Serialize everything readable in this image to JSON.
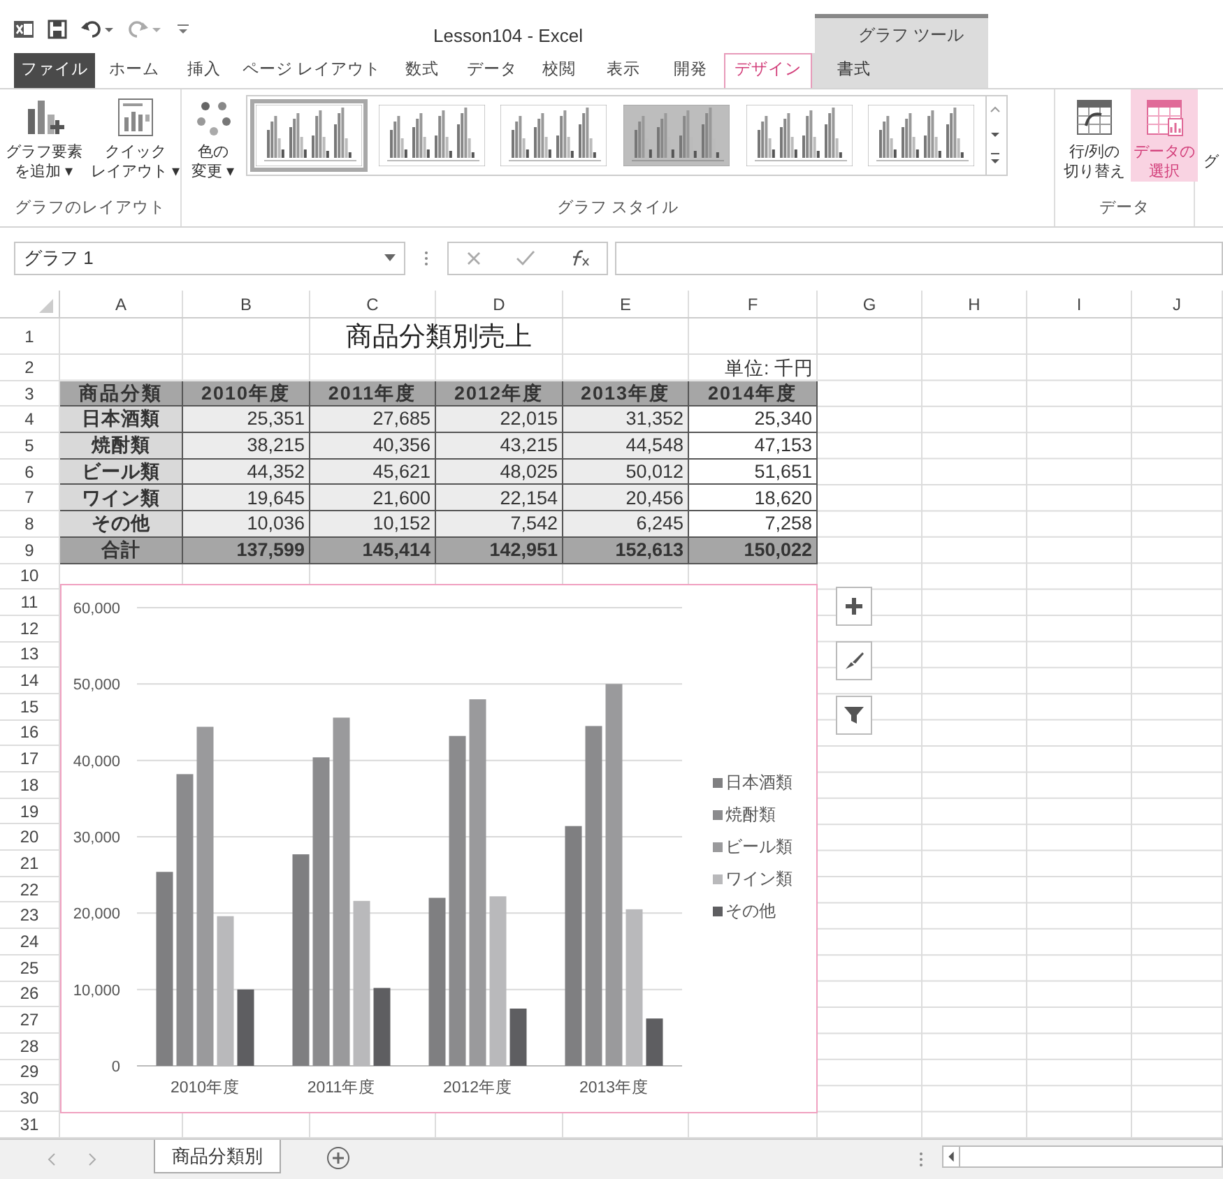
{
  "title_bar": {
    "title": "Lesson104 - Excel",
    "context_group": "グラフ ツール"
  },
  "ribbon_tabs": [
    {
      "label": "ファイル",
      "kind": "file",
      "selected": false
    },
    {
      "label": "ホーム",
      "kind": "normal",
      "selected": false
    },
    {
      "label": "挿入",
      "kind": "normal",
      "selected": false
    },
    {
      "label": "ページ レイアウト",
      "kind": "normal",
      "selected": false
    },
    {
      "label": "数式",
      "kind": "normal",
      "selected": false
    },
    {
      "label": "データ",
      "kind": "normal",
      "selected": false
    },
    {
      "label": "校閲",
      "kind": "normal",
      "selected": false
    },
    {
      "label": "表示",
      "kind": "normal",
      "selected": false
    },
    {
      "label": "開発",
      "kind": "normal",
      "selected": false
    },
    {
      "label": "デザイン",
      "kind": "context",
      "selected": true
    },
    {
      "label": "書式",
      "kind": "context",
      "selected": false
    }
  ],
  "ribbon": {
    "layout_group": {
      "label": "グラフのレイアウト",
      "buttons": [
        {
          "kind": "add-element",
          "lines": [
            "グラフ要素",
            "を追加 ▾"
          ]
        },
        {
          "kind": "quick-layout",
          "lines": [
            "クイック",
            "レイアウト ▾"
          ]
        }
      ]
    },
    "style_group": {
      "label": "グラフ スタイル",
      "color_button": {
        "lines": [
          "色の",
          "変更 ▾"
        ]
      },
      "styles": [
        {
          "selected": true,
          "shaded": false
        },
        {
          "selected": false,
          "shaded": false
        },
        {
          "selected": false,
          "shaded": false
        },
        {
          "selected": false,
          "shaded": true
        },
        {
          "selected": false,
          "shaded": false
        },
        {
          "selected": false,
          "shaded": false
        }
      ]
    },
    "data_group": {
      "label": "データ",
      "buttons": [
        {
          "kind": "switch",
          "lines": [
            "行/列の",
            "切り替え"
          ],
          "selected": false
        },
        {
          "kind": "select-data",
          "lines": [
            "データの",
            "選択"
          ],
          "selected": true
        }
      ]
    },
    "cut_off_label": "グ"
  },
  "formula_bar": {
    "name_box": "グラフ 1"
  },
  "sheet": {
    "columns": [
      "A",
      "B",
      "C",
      "D",
      "E",
      "F",
      "G",
      "H",
      "I",
      "J"
    ],
    "row_numbers": [
      "1",
      "2",
      "3",
      "4",
      "5",
      "6",
      "7",
      "8",
      "9",
      "10",
      "11",
      "12",
      "13",
      "14",
      "15",
      "16",
      "17",
      "18",
      "19",
      "20",
      "21",
      "22",
      "23",
      "24",
      "25",
      "26",
      "27",
      "28",
      "29",
      "30",
      "31"
    ],
    "title": "商品分類別売上",
    "unit": "単位: 千円",
    "header": [
      "商品分類",
      "2010年度",
      "2011年度",
      "2012年度",
      "2013年度",
      "2014年度"
    ],
    "rows": [
      {
        "label": "日本酒類",
        "values": [
          "25,351",
          "27,685",
          "22,015",
          "31,352",
          "25,340"
        ]
      },
      {
        "label": "焼酎類",
        "values": [
          "38,215",
          "40,356",
          "43,215",
          "44,548",
          "47,153"
        ]
      },
      {
        "label": "ビール類",
        "values": [
          "44,352",
          "45,621",
          "48,025",
          "50,012",
          "51,651"
        ]
      },
      {
        "label": "ワイン類",
        "values": [
          "19,645",
          "21,600",
          "22,154",
          "20,456",
          "18,620"
        ]
      },
      {
        "label": "その他",
        "values": [
          "10,036",
          "10,152",
          "7,542",
          "6,245",
          "7,258"
        ]
      }
    ],
    "total": {
      "label": "合計",
      "values": [
        "137,599",
        "145,414",
        "142,951",
        "152,613",
        "150,022"
      ]
    }
  },
  "chart": {
    "chart_data": {
      "type": "bar",
      "categories": [
        "2010年度",
        "2011年度",
        "2012年度",
        "2013年度"
      ],
      "series": [
        {
          "name": "日本酒類",
          "color": "#7f7f81",
          "values": [
            25400,
            27700,
            22000,
            31400
          ]
        },
        {
          "name": "焼酎類",
          "color": "#8b8b8d",
          "values": [
            38200,
            40400,
            43200,
            44500
          ]
        },
        {
          "name": "ビール類",
          "color": "#9a9a9c",
          "values": [
            44400,
            45600,
            48000,
            50000
          ]
        },
        {
          "name": "ワイン類",
          "color": "#b9b9bb",
          "values": [
            19600,
            21600,
            22200,
            20500
          ]
        },
        {
          "name": "その他",
          "color": "#5e5e61",
          "values": [
            10000,
            10200,
            7500,
            6200
          ]
        }
      ],
      "grid": true,
      "legend": true,
      "ylim": [
        0,
        60000
      ],
      "yticks": [
        {
          "value": 0,
          "label": "0"
        },
        {
          "value": 10000,
          "label": "10,000"
        },
        {
          "value": 20000,
          "label": "20,000"
        },
        {
          "value": 30000,
          "label": "30,000"
        },
        {
          "value": 40000,
          "label": "40,000"
        },
        {
          "value": 50000,
          "label": "50,000"
        },
        {
          "value": 60000,
          "label": "60,000"
        }
      ]
    }
  },
  "sheet_tabs": [
    {
      "label": "商品分類別",
      "selected": true
    }
  ]
}
